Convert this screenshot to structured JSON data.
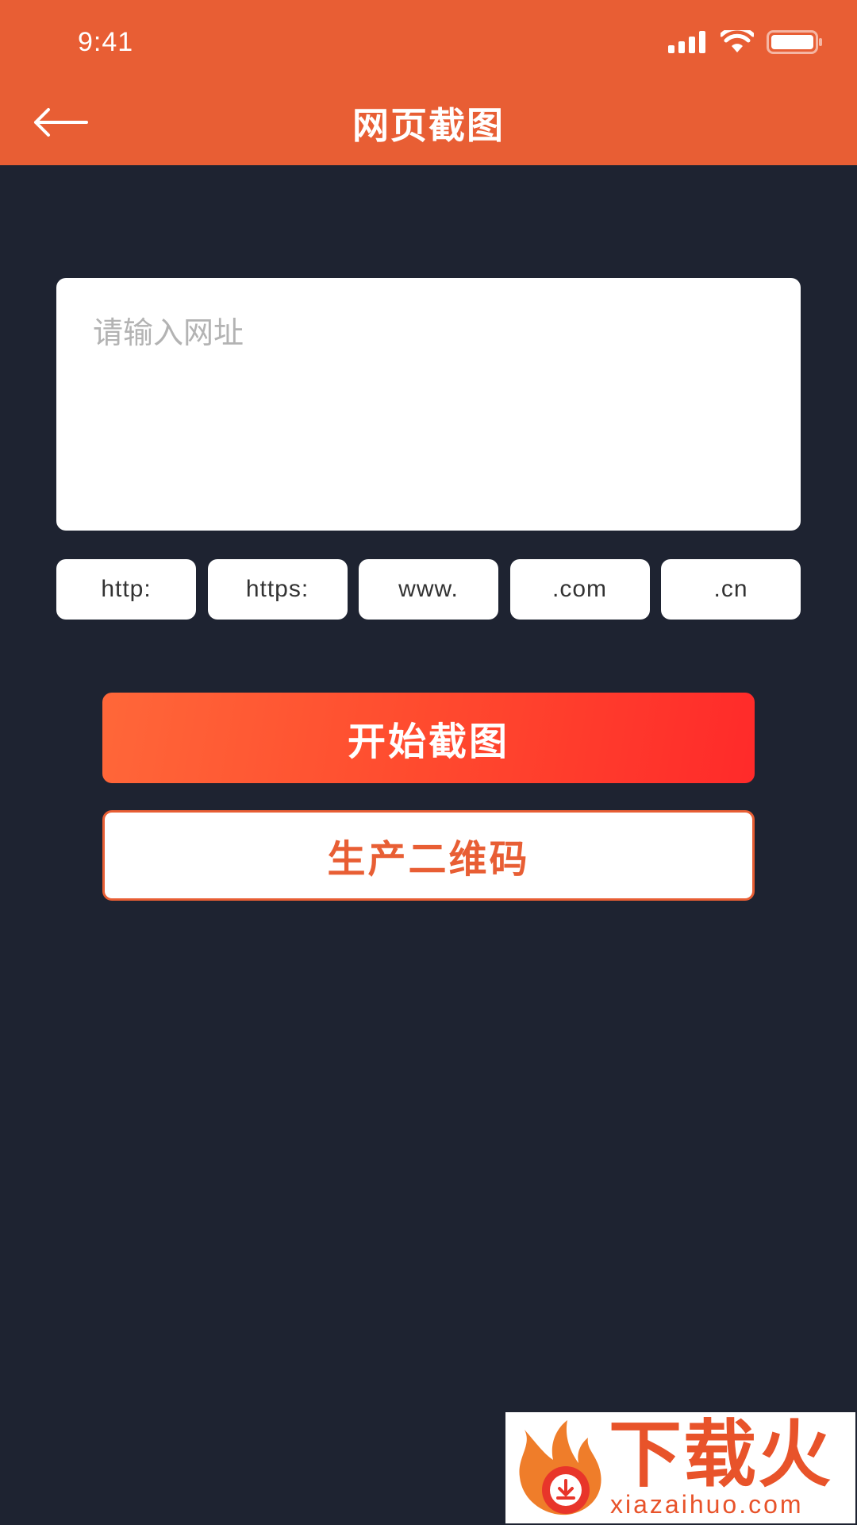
{
  "status_bar": {
    "time": "9:41"
  },
  "header": {
    "title": "网页截图",
    "back_icon": "arrow-left-icon"
  },
  "url_input": {
    "placeholder": "请输入网址",
    "value": ""
  },
  "chips": [
    {
      "label": "http:"
    },
    {
      "label": "https:"
    },
    {
      "label": "www."
    },
    {
      "label": ".com"
    },
    {
      "label": ".cn"
    }
  ],
  "actions": {
    "start_label": "开始截图",
    "qr_label": "生产二维码"
  },
  "watermark": {
    "text": "下载火",
    "domain": "xiazaihuo.com"
  },
  "colors": {
    "header": "#e85e34",
    "background": "#1e2331",
    "primary_start": "#ff6739",
    "primary_end": "#ff2a2a",
    "accent": "#e85e34"
  }
}
